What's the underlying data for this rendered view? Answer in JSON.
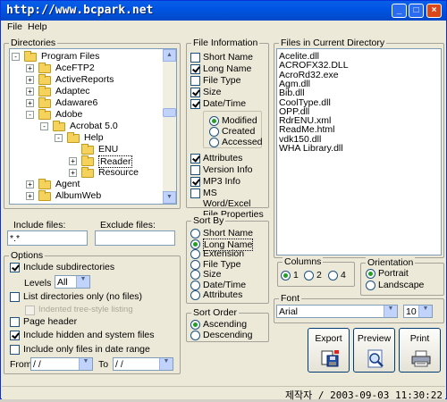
{
  "title": "http://www.bcpark.net",
  "menu": [
    "File",
    "Help"
  ],
  "directories": {
    "label": "Directories",
    "tree": [
      {
        "label": "Program Files",
        "expander": "-"
      },
      {
        "label": "AceFTP2",
        "expander": "+"
      },
      {
        "label": "ActiveReports",
        "expander": "+"
      },
      {
        "label": "Adaptec",
        "expander": "+"
      },
      {
        "label": "Adaware6",
        "expander": "+"
      },
      {
        "label": "Adobe",
        "expander": "-"
      },
      {
        "label": "Acrobat 5.0",
        "expander": "-"
      },
      {
        "label": "Help",
        "expander": "-"
      },
      {
        "label": "ENU",
        "expander": ""
      },
      {
        "label": "Reader",
        "expander": "+"
      },
      {
        "label": "Resource",
        "expander": "+"
      },
      {
        "label": "Agent",
        "expander": "+"
      },
      {
        "label": "AlbumWeb",
        "expander": "+"
      }
    ]
  },
  "include_files": {
    "label": "Include files:",
    "value": "*.*"
  },
  "exclude_files": {
    "label": "Exclude files:",
    "value": ""
  },
  "options": {
    "label": "Options",
    "include_subdirectories": "Include subdirectories",
    "levels_label": "Levels",
    "levels_value": "All",
    "list_dirs_only": "List directories only (no files)",
    "indented_tree": "Indented tree-style listing",
    "page_header": "Page header",
    "include_hidden": "Include hidden and system files",
    "date_range": "Include only files in date range",
    "from_label": "From",
    "from_value": " / /",
    "to_label": "To",
    "to_value": " / /"
  },
  "file_information": {
    "label": "File Information",
    "items": [
      "Short Name",
      "Long Name",
      "File Type",
      "Size",
      "Date/Time"
    ],
    "checked": [
      false,
      true,
      false,
      true,
      true
    ],
    "date_options": [
      "Modified",
      "Created",
      "Accessed"
    ],
    "date_selected": 0,
    "extra_items": [
      "Attributes",
      "Version Info",
      "MP3 Info",
      "MS Word/Excel File Properties"
    ],
    "extra_checked": [
      true,
      false,
      true,
      false
    ]
  },
  "sort_by": {
    "label": "Sort By",
    "options": [
      "Short Name",
      "Long Name",
      "Extension",
      "File Type",
      "Size",
      "Date/Time",
      "Attributes"
    ],
    "selected": 1
  },
  "sort_order": {
    "label": "Sort Order",
    "options": [
      "Ascending",
      "Descending"
    ],
    "selected": 0
  },
  "files": {
    "label": "Files in Current Directory",
    "items": [
      "Acelite.dll",
      "ACROFX32.DLL",
      "AcroRd32.exe",
      "Agm.dll",
      "Bib.dll",
      "CoolType.dll",
      "OPP.dll",
      "RdrENU.xml",
      "ReadMe.html",
      "vdk150.dll",
      "WHA Library.dll"
    ]
  },
  "columns": {
    "label": "Columns",
    "options": [
      "1",
      "2",
      "4"
    ],
    "selected": 0
  },
  "orientation": {
    "label": "Orientation",
    "options": [
      "Portrait",
      "Landscape"
    ],
    "selected": 0
  },
  "font": {
    "label": "Font",
    "name": "Arial",
    "size": "10"
  },
  "buttons": {
    "export": "Export",
    "preview": "Preview",
    "print": "Print"
  },
  "status": "제작자 / 2003-09-03 11:30:22",
  "colors": {
    "title_bar": "#0054e3",
    "face": "#ece9d8",
    "check": "#21a121",
    "selection": "#316ac5"
  }
}
